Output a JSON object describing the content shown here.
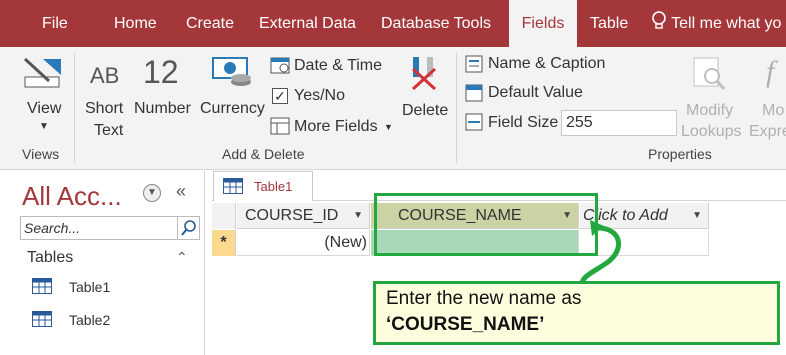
{
  "ribbon_tabs": {
    "file": "File",
    "home": "Home",
    "create": "Create",
    "external_data": "External Data",
    "database_tools": "Database Tools",
    "fields": "Fields",
    "table": "Table",
    "tell_me": "Tell me what yo"
  },
  "views_group": {
    "view_label": "View",
    "group_label": "Views"
  },
  "add_delete_group": {
    "short_text_icon": "AB",
    "short_text_l1": "Short",
    "short_text_l2": "Text",
    "number_icon": "12",
    "number_label": "Number",
    "currency_label": "Currency",
    "date_time": "Date & Time",
    "yes_no": "Yes/No",
    "more_fields": "More Fields",
    "delete_label": "Delete",
    "group_label": "Add & Delete"
  },
  "properties_group": {
    "name_caption": "Name & Caption",
    "default_value": "Default Value",
    "field_size_label": "Field Size",
    "field_size_value": "255",
    "modify_l1": "Modify",
    "modify_l2": "Lookups",
    "expr_l1": "Mo",
    "expr_l2": "Expre",
    "group_label": "Properties"
  },
  "nav_pane": {
    "title": "All Acc...",
    "search_placeholder": "Search...",
    "section": "Tables",
    "items": [
      "Table1",
      "Table2"
    ]
  },
  "document": {
    "tab_label": "Table1",
    "columns": [
      "COURSE_ID",
      "COURSE_NAME",
      "Click to Add"
    ],
    "new_row_marker": "*",
    "new_row_value": "(New)"
  },
  "annotation": {
    "line1": "Enter the new name as",
    "line2": "‘COURSE_NAME’"
  },
  "colors": {
    "accent": "#a4373a",
    "highlight_green": "#22a83e",
    "selected_header": "#c9d3a4"
  }
}
